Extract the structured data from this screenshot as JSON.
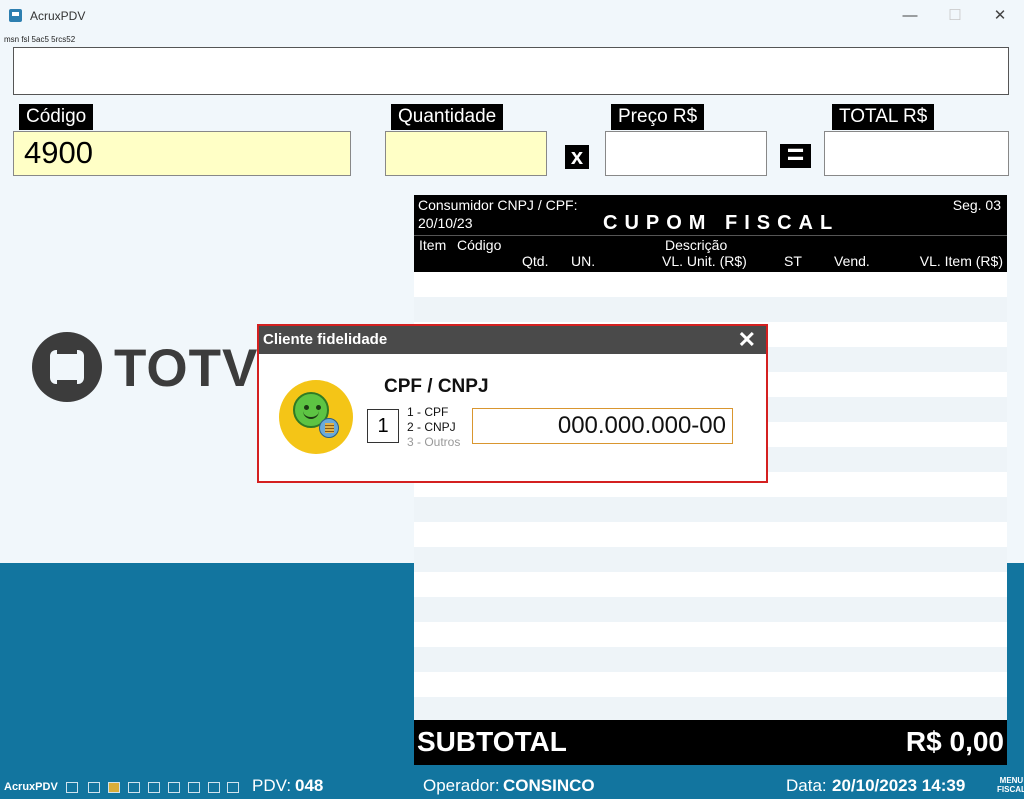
{
  "window": {
    "title": "AcruxPDV",
    "minimize": "—",
    "maximize": "☐",
    "close": "✕"
  },
  "top_message": "",
  "top_message_garbled": "msn fsl 5ac5 5rcs52",
  "fields": {
    "codigo": {
      "label": "Código",
      "value": "4900"
    },
    "quantidade": {
      "label": "Quantidade",
      "value": ""
    },
    "multiply": "x",
    "preco": {
      "label": "Preço R$",
      "value": ""
    },
    "equals": "=",
    "total": {
      "label": "TOTAL R$",
      "value": ""
    }
  },
  "logo": {
    "text": "TOTVS"
  },
  "cupom": {
    "consumidor": "Consumidor CNPJ / CPF:",
    "seq": "Seg. 03",
    "date": "20/10/23",
    "title": "CUPOM FISCAL",
    "columns": {
      "item": "Item",
      "codigo": "Código",
      "descricao": "Descrição",
      "qtd": "Qtd.",
      "un": "UN.",
      "vl_unit": "VL. Unit. (R$)",
      "st": "ST",
      "vend": "Vend.",
      "vl_item": "VL. Item (R$)"
    },
    "subtotal_label": "SUBTOTAL",
    "subtotal_value": "R$ 0,00"
  },
  "dialog": {
    "title": "Cliente fidelidade",
    "close": "✕",
    "heading": "CPF / CNPJ",
    "type_value": "1",
    "options": [
      "1 - CPF",
      "2 - CNPJ",
      "3 - Outros"
    ],
    "document_value": "000.000.000-00",
    "colors": {
      "border": "#d42020",
      "input_border": "#d9962f"
    }
  },
  "statusbar": {
    "app": "AcruxPDV",
    "pdv_label": "PDV:",
    "pdv_value": "048",
    "operador_label": "Operador:",
    "operador_value": "CONSINCO",
    "data_label": "Data:",
    "data_value": "20/10/2023 14:39",
    "menu_line1": "MENU",
    "menu_line2": "FISCAL",
    "icons": [
      "network-icon",
      "computer-icon",
      "printer-icon",
      "card-reader-icon",
      "keyboard-icon",
      "shield-icon",
      "scale-icon",
      "barcode-icon",
      "grid-icon"
    ]
  },
  "colors": {
    "accent_blue": "#12759f",
    "yellow_field": "#ffffc6"
  }
}
